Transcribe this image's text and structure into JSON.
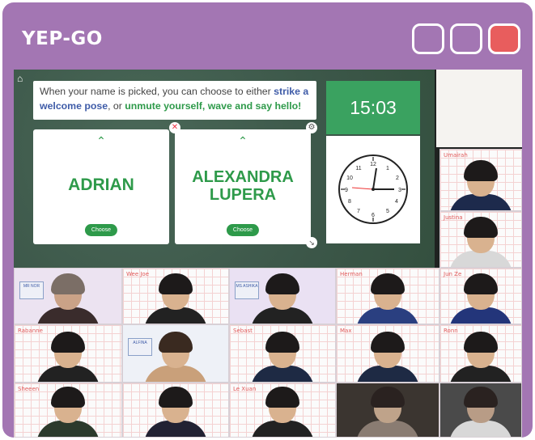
{
  "app": {
    "title": "YEP-GO"
  },
  "window_controls": {
    "colors": {
      "close": "#e85d5d",
      "frame": "#a376b3"
    }
  },
  "board": {
    "instruction": {
      "part1": "When your name is picked, you can choose to either ",
      "part2": "strike a welcome pose",
      "part3": ", or ",
      "part4": "unmute yourself, wave and say hello!"
    },
    "cards": [
      {
        "name": "ADRIAN",
        "button": "Choose"
      },
      {
        "name": "ALEXANDRA LUPERA",
        "button": "Choose"
      }
    ],
    "timer": "15:03",
    "icons": {
      "home": "home-icon",
      "close": "close-icon",
      "settings": "gear-icon",
      "resize": "resize-icon"
    }
  },
  "participants": [
    {
      "name": "Umairah"
    },
    {
      "name": "Justina"
    },
    {
      "name": ""
    },
    {
      "name": "Wee Joe"
    },
    {
      "name": ""
    },
    {
      "name": "Herman"
    },
    {
      "name": "Jun Ze"
    },
    {
      "name": "Rabanne"
    },
    {
      "name": ""
    },
    {
      "name": "Sebast"
    },
    {
      "name": "Max"
    },
    {
      "name": "Ronn"
    },
    {
      "name": "Sheeen"
    },
    {
      "name": ""
    },
    {
      "name": "Le Xuan"
    },
    {
      "name": ""
    },
    {
      "name": ""
    }
  ],
  "badges": {
    "b1": "MR NOR ",
    "b2": "MS ASHIKA",
    "b3": "ALFINA"
  }
}
